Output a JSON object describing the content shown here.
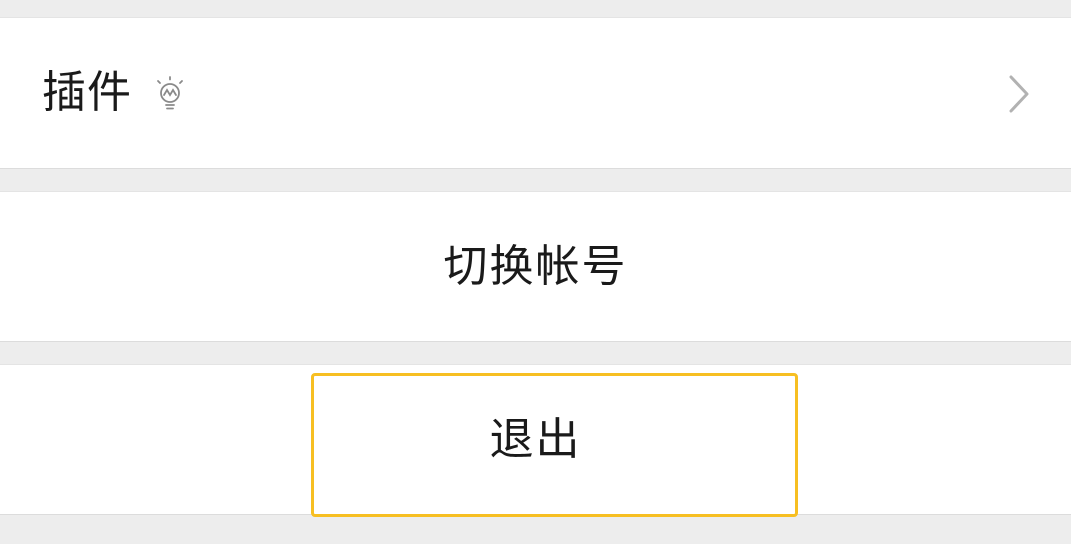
{
  "settings": {
    "plugins": {
      "label": "插件",
      "icon": "lightbulb-icon"
    },
    "switch_account": {
      "label": "切换帐号"
    },
    "logout": {
      "label": "退出",
      "focused": true
    }
  },
  "colors": {
    "background": "#ededed",
    "row": "#ffffff",
    "text": "#1a1a1a",
    "icon": "#8a8a8a",
    "chevron": "#b2b2b2",
    "focus": "#f7bf22"
  }
}
